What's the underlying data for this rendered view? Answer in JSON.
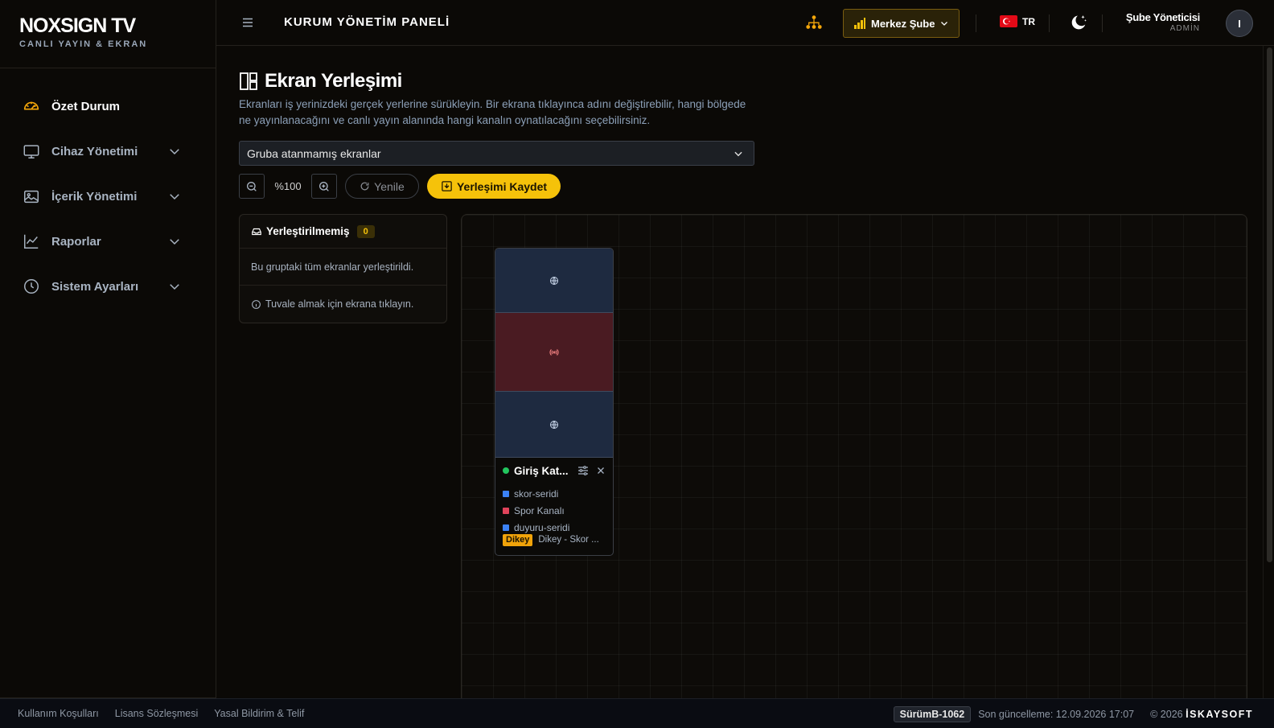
{
  "brand": {
    "title": "NOXSIGN TV",
    "subtitle": "CANLI YAYIN & EKRAN"
  },
  "sidebar": {
    "items": [
      {
        "label": "Özet Durum",
        "icon": "gauge-icon",
        "active": true,
        "expandable": false
      },
      {
        "label": "Cihaz Yönetimi",
        "icon": "monitor-icon",
        "active": false,
        "expandable": true
      },
      {
        "label": "İçerik Yönetimi",
        "icon": "images-icon",
        "active": false,
        "expandable": true
      },
      {
        "label": "Raporlar",
        "icon": "chart-line-icon",
        "active": false,
        "expandable": true
      },
      {
        "label": "Sistem Ayarları",
        "icon": "clock-icon",
        "active": false,
        "expandable": true
      }
    ]
  },
  "topbar": {
    "title": "KURUM YÖNETİM PANELİ",
    "branch": "Merkez Şube",
    "language": "TR",
    "user_name": "Şube Yöneticisi",
    "user_role": "ADMİN",
    "avatar_initial": "I"
  },
  "page": {
    "title": "Ekran Yerleşimi",
    "description": "Ekranları iş yerinizdeki gerçek yerlerine sürükleyin. Bir ekrana tıklayınca adını değiştirebilir, hangi bölgede ne yayınlanacağını ve canlı yayın alanında hangi kanalın oynatılacağını seçebilirsiniz.",
    "group_select_value": "Gruba atanmamış ekranlar",
    "zoom_level": "%100",
    "refresh_label": "Yenile",
    "save_label": "Yerleşimi Kaydet"
  },
  "unplaced": {
    "title": "Yerleştirilmemiş",
    "count": "0",
    "message": "Bu gruptaki tüm ekranlar yerleştirildi.",
    "hint": "Tuvale almak için ekrana tıklayın."
  },
  "canvas": {
    "screens": [
      {
        "name": "Giriş Kat...",
        "status": "online",
        "zones": [
          {
            "name": "skor-seridi",
            "color": "#3b82f6",
            "icon": "globe-icon"
          },
          {
            "name": "Spor Kanalı",
            "color": "#e0435a",
            "icon": "broadcast-icon"
          },
          {
            "name": "duyuru-seridi",
            "color": "#3b82f6",
            "icon": "globe-icon"
          }
        ],
        "orientation": "Dikey",
        "layout": "Dikey - Skor ..."
      }
    ]
  },
  "footer": {
    "links": [
      "Kullanım Koşulları",
      "Lisans Sözleşmesi",
      "Yasal Bildirim & Telif"
    ],
    "version": "SürümB-1062",
    "last_update": "Son güncelleme: 12.09.2026 17:07",
    "copyright_prefix": "© 2026",
    "company": "İSKAYSOFT"
  },
  "colors": {
    "accent": "#f5c20a",
    "online": "#22c55e",
    "zone_web": "#1e2a40",
    "zone_live": "#4a1b22"
  }
}
